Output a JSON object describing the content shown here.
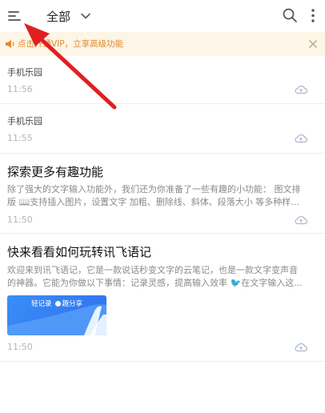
{
  "header": {
    "title": "全部",
    "menu_icon": "hamburger-icon",
    "dropdown_icon": "chevron-down-icon",
    "search_icon": "search-icon",
    "more_icon": "more-vertical-icon"
  },
  "banner": {
    "text": "点击开通VIP，立享高级功能",
    "icon": "speaker-icon",
    "close_icon": "close-icon",
    "text_color": "#e08a2c",
    "bg_color": "#fdf5e6"
  },
  "notes": [
    {
      "title": "手机乐园",
      "time": "11:56"
    },
    {
      "title": "手机乐园",
      "time": "11:55"
    },
    {
      "title": "探索更多有趣功能",
      "body_line1": "除了强大的文字输入功能外，我们还为你准备了一些有趣的小功能： 图文排",
      "body_line2": "版 📖支持插入图片，设置文字 加粗、删除线、斜体、段落大小 等多种样...",
      "time": "11:50"
    },
    {
      "title": "快来看看如何玩转讯飞语记",
      "body_line1": "欢迎来到讯飞语记，它是一款说话秒变文字的云笔记，也是一款文字变声音",
      "body_line2": "的神器。它能为你做以下事情：记录灵感，提高输入效率 🐦在文字输入这...",
      "thumb_text_left": "轻记录",
      "thumb_text_right": "趣分享",
      "time": "11:50"
    }
  ],
  "colors": {
    "accent_blue": "#2f6ff0",
    "annotation_arrow": "#e02020"
  }
}
